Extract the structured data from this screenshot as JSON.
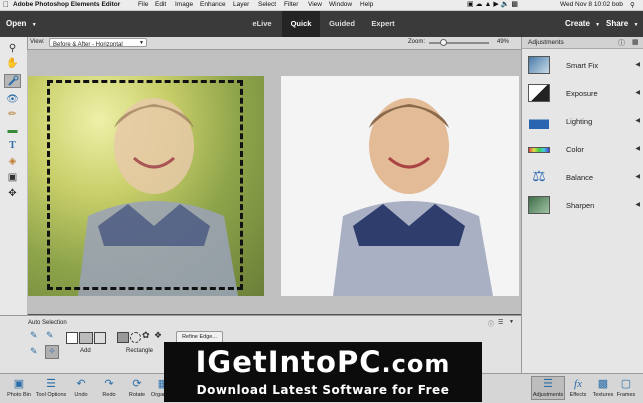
{
  "menubar": {
    "app_name": "Adobe Photoshop Elements Editor",
    "menus": [
      "File",
      "Edit",
      "Image",
      "Enhance",
      "Layer",
      "Select",
      "Filter",
      "View",
      "Window",
      "Help"
    ],
    "clock": "Wed Nov 8  10:02",
    "user": "bob"
  },
  "appbar": {
    "open_label": "Open",
    "modes": [
      "eLive",
      "Quick",
      "Guided",
      "Expert"
    ],
    "active_mode": "Quick",
    "create_label": "Create",
    "share_label": "Share"
  },
  "options": {
    "view_label": "View:",
    "view_value": "Before & After - Horizontal",
    "zoom_label": "Zoom:",
    "zoom_value": "49%",
    "zoom_fraction": 0.49
  },
  "panel": {
    "title": "Adjustments",
    "items": [
      {
        "label": "Smart Fix",
        "icon": "smart-fix-icon"
      },
      {
        "label": "Exposure",
        "icon": "exposure-icon"
      },
      {
        "label": "Lighting",
        "icon": "lighting-icon"
      },
      {
        "label": "Color",
        "icon": "color-icon"
      },
      {
        "label": "Balance",
        "icon": "balance-icon"
      },
      {
        "label": "Sharpen",
        "icon": "sharpen-icon"
      }
    ]
  },
  "tool_options": {
    "section_label": "Auto Selection",
    "add_label": "Add",
    "rectangle_label": "Rectangle",
    "refine_edge_label": "Refine Edge..."
  },
  "bottombar": {
    "left": [
      {
        "label": "Photo Bin",
        "icon": "photo-bin-icon"
      },
      {
        "label": "Tool Options",
        "icon": "tool-options-icon"
      },
      {
        "label": "Undo",
        "icon": "undo-icon"
      },
      {
        "label": "Redo",
        "icon": "redo-icon"
      },
      {
        "label": "Rotate",
        "icon": "rotate-icon"
      },
      {
        "label": "Organizer",
        "icon": "organizer-icon"
      }
    ],
    "right": [
      {
        "label": "Adjustments",
        "icon": "adjustments-icon"
      },
      {
        "label": "Effects",
        "icon": "effects-icon"
      },
      {
        "label": "Textures",
        "icon": "textures-icon"
      },
      {
        "label": "Frames",
        "icon": "frames-icon"
      }
    ]
  },
  "watermark": {
    "title_big": "IGetIntoPC",
    "title_suffix": ".com",
    "tagline": "Download Latest Software for Free"
  }
}
